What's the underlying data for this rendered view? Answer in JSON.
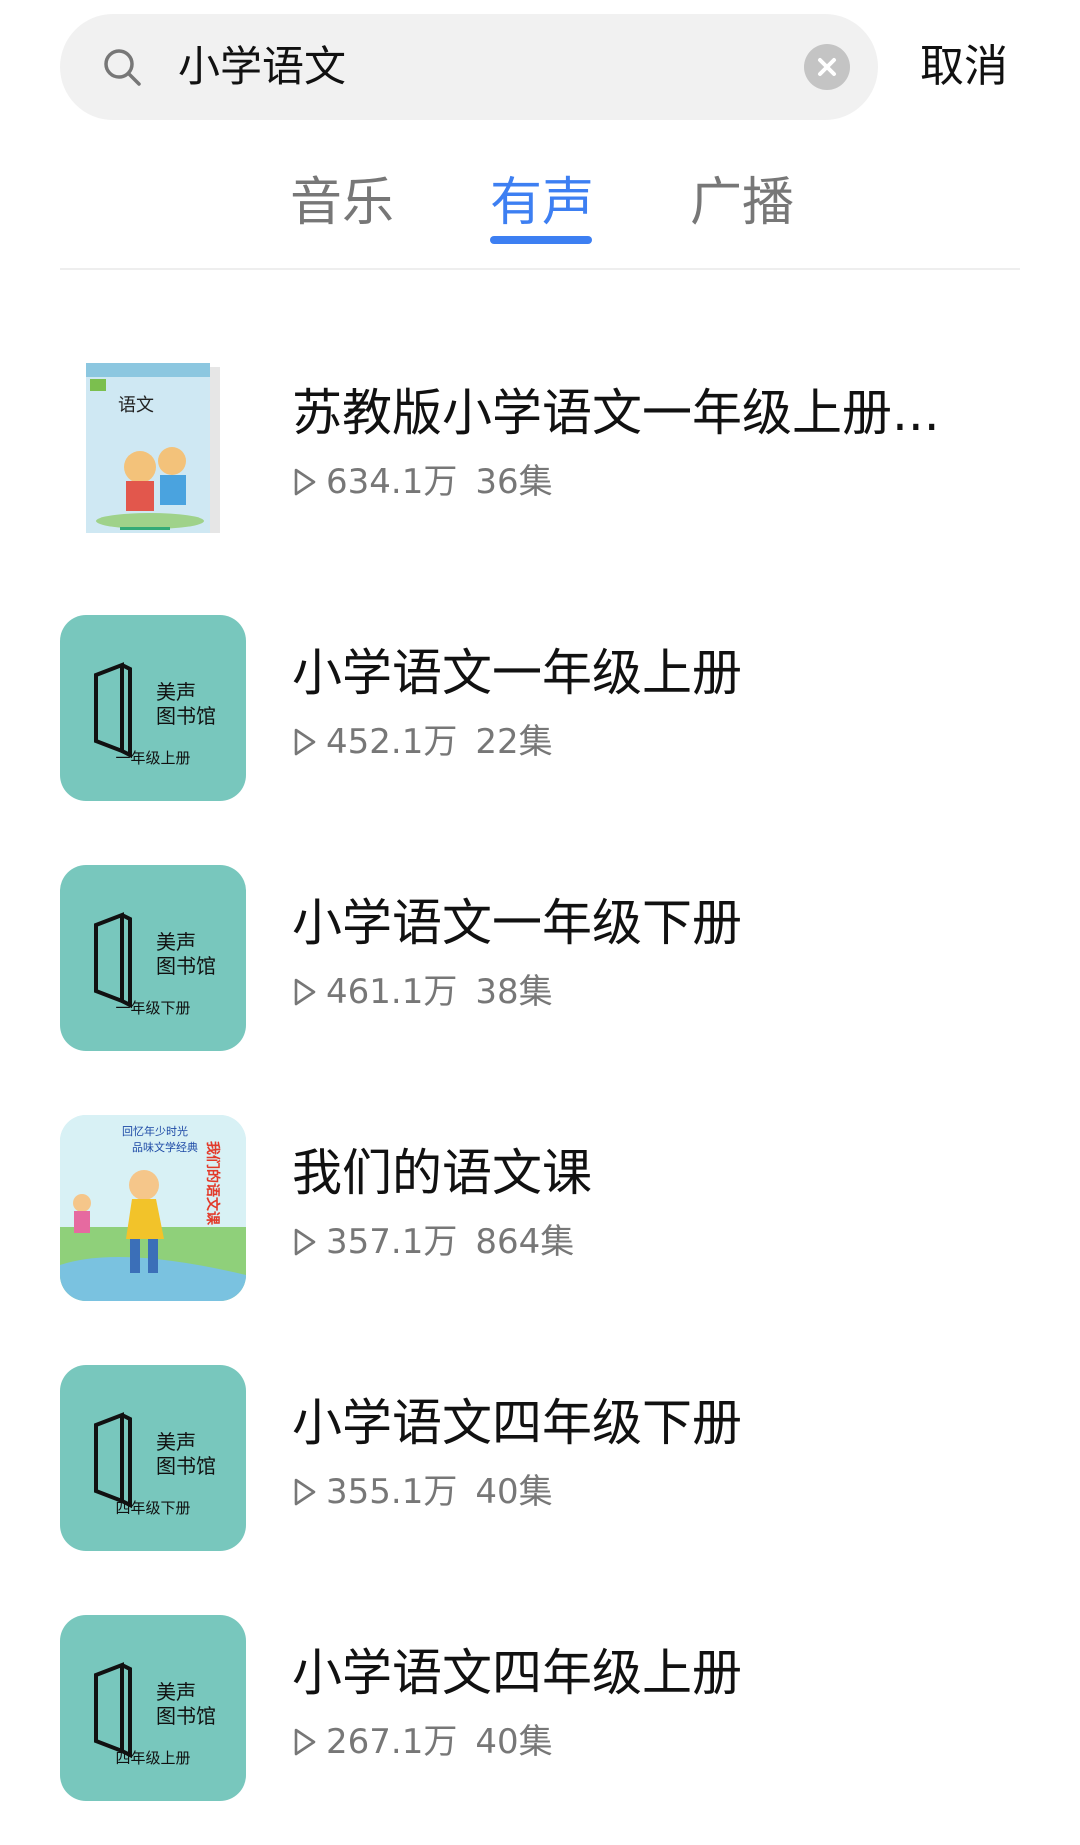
{
  "search": {
    "query": "小学语文",
    "cancel_label": "取消"
  },
  "tabs": [
    {
      "label": "音乐",
      "active": false
    },
    {
      "label": "有声",
      "active": true
    },
    {
      "label": "广播",
      "active": false
    }
  ],
  "colors": {
    "accent": "#3d7ff2",
    "cover_teal": "#78c7bd"
  },
  "cover_text": {
    "line1": "美声",
    "line2": "图书馆",
    "book_title": "语文",
    "storybook_line1": "回忆年少时光",
    "storybook_line2": "品味文学经典",
    "storybook_title": "我们的语文课"
  },
  "results": [
    {
      "title": "苏教版小学语文一年级上册...",
      "plays": "634.1万",
      "episodes": "36集",
      "cover": "textbook-cover"
    },
    {
      "title": "小学语文一年级上册",
      "plays": "452.1万",
      "episodes": "22集",
      "cover": "meisheng-cover",
      "cover_caption": "一年级上册"
    },
    {
      "title": "小学语文一年级下册",
      "plays": "461.1万",
      "episodes": "38集",
      "cover": "meisheng-cover",
      "cover_caption": "一年级下册"
    },
    {
      "title": "我们的语文课",
      "plays": "357.1万",
      "episodes": "864集",
      "cover": "storybook-cover"
    },
    {
      "title": "小学语文四年级下册",
      "plays": "355.1万",
      "episodes": "40集",
      "cover": "meisheng-cover",
      "cover_caption": "四年级下册"
    },
    {
      "title": "小学语文四年级上册",
      "plays": "267.1万",
      "episodes": "40集",
      "cover": "meisheng-cover",
      "cover_caption": "四年级上册"
    }
  ]
}
